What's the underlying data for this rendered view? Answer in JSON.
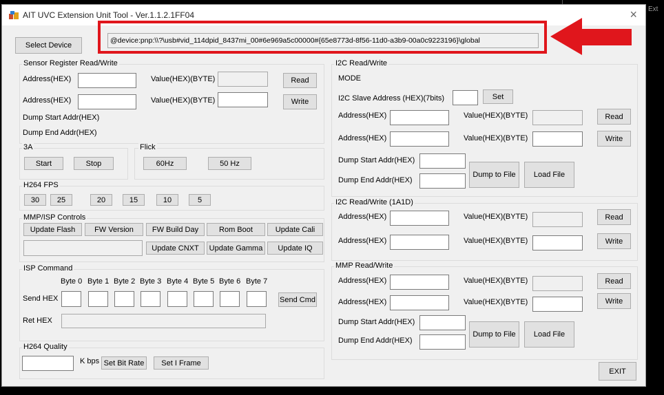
{
  "window": {
    "title": "AIT UVC Extension Unit Tool - Ver.1.1.2.1FF04",
    "close_glyph": "×",
    "bg_fragment": "Ext"
  },
  "device": {
    "select_label": "Select Device",
    "path": "@device:pnp:\\\\?\\usb#vid_114dpid_8437mi_00#6e969a5c00000#{65e8773d-8f56-11d0-a3b9-00a0c9223196}\\global"
  },
  "sensor": {
    "title": "Sensor Register Read/Write",
    "address_label": "Address(HEX)",
    "value_label": "Value(HEX)(BYTE)",
    "read_label": "Read",
    "write_label": "Write",
    "dump_start_label": "Dump Start Addr(HEX)",
    "dump_end_label": "Dump End Addr(HEX)"
  },
  "three_a": {
    "title": "3A",
    "start_label": "Start",
    "stop_label": "Stop"
  },
  "flick": {
    "title": "Flick",
    "hz60_label": "60Hz",
    "hz50_label": "50 Hz"
  },
  "h264_fps": {
    "title": "H264 FPS",
    "options": [
      "30",
      "25",
      "20",
      "15",
      "10",
      "5"
    ]
  },
  "mmp_isp": {
    "title": "MMP/ISP Controls",
    "update_flash": "Update Flash",
    "fw_version": "FW Version",
    "fw_build_day": "FW Build Day",
    "rom_boot": "Rom Boot",
    "update_cali": "Update Cali",
    "update_cnxt": "Update CNXT",
    "update_gamma": "Update Gamma",
    "update_iq": "Update IQ"
  },
  "isp_command": {
    "title": "ISP Command",
    "bytes": [
      "Byte 0",
      "Byte 1",
      "Byte 2",
      "Byte 3",
      "Byte 4",
      "Byte 5",
      "Byte 6",
      "Byte 7"
    ],
    "send_label": "Send  HEX",
    "ret_label": "Ret  HEX",
    "send_cmd_label": "Send Cmd"
  },
  "h264_quality": {
    "title": "H264 Quality",
    "kbps_label": "K bps",
    "set_bit_rate": "Set Bit Rate",
    "set_i_frame": "Set I Frame"
  },
  "i2c": {
    "title": "I2C Read/Write",
    "mode_label": "MODE",
    "slave_label": "I2C Slave Address (HEX)(7bits)",
    "set_label": "Set",
    "address_label": "Address(HEX)",
    "value_label": "Value(HEX)(BYTE)",
    "read_label": "Read",
    "write_label": "Write",
    "dump_start_label": "Dump Start Addr(HEX)",
    "dump_end_label": "Dump End Addr(HEX)",
    "dump_to_file": "Dump to File",
    "load_file": "Load File"
  },
  "i2c_1a1d": {
    "title": "I2C Read/Write (1A1D)",
    "address_label": "Address(HEX)",
    "value_label": "Value(HEX)(BYTE)",
    "read_label": "Read",
    "write_label": "Write"
  },
  "mmp": {
    "title": "MMP Read/Write",
    "address_label": "Address(HEX)",
    "value_label": "Value(HEX)(BYTE)",
    "read_label": "Read",
    "write_label": "Write",
    "dump_start_label": "Dump Start Addr(HEX)",
    "dump_end_label": "Dump End Addr(HEX)",
    "dump_to_file": "Dump to File",
    "load_file": "Load File"
  },
  "exit_label": "EXIT",
  "colors": {
    "annotation_red": "#e0161c",
    "window_bg": "#f0f0f0"
  }
}
